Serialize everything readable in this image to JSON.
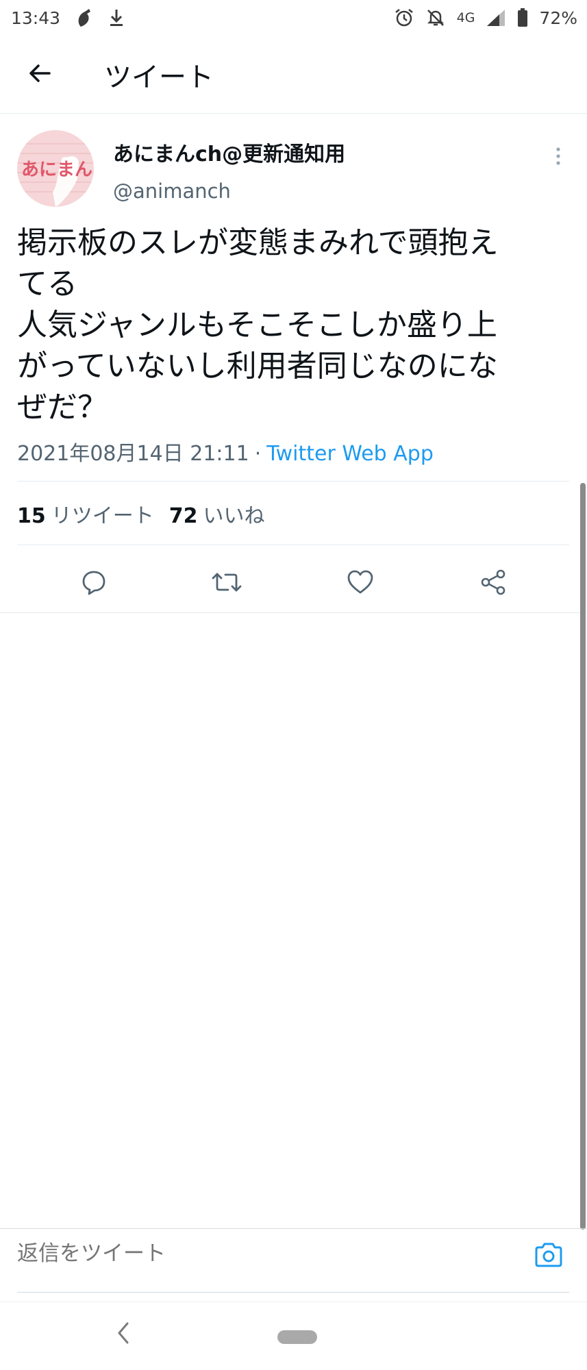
{
  "status_bar": {
    "time": "13:43",
    "network": "4G",
    "battery": "72%",
    "icons": [
      "app-notification-icon",
      "download-icon",
      "alarm-icon",
      "mute-icon",
      "signal-icon",
      "battery-icon"
    ]
  },
  "header": {
    "title": "ツイート",
    "back_icon": "arrow-left-icon"
  },
  "tweet": {
    "author": {
      "display_name": "あにまんch@更新通知用",
      "handle": "@animanch",
      "avatar_text": "あにまん"
    },
    "text": "掲示板のスレが変態まみれで頭抱え\nてる\n人気ジャンルもそこそこしか盛り上\nがっていないし利用者同じなのにな\nぜだ？",
    "timestamp": "2021年08月14日 21:11",
    "separator": "·",
    "source": "Twitter Web App",
    "retweets": {
      "count": "15",
      "label": "リツイート"
    },
    "likes": {
      "count": "72",
      "label": "いいね"
    },
    "actions": [
      "reply-icon",
      "retweet-icon",
      "like-icon",
      "share-icon"
    ]
  },
  "reply": {
    "placeholder": "返信をツイート",
    "camera_icon": "camera-icon"
  },
  "colors": {
    "accent": "#1d9bf0",
    "text_primary": "#0f1419",
    "text_secondary": "#536471",
    "divider": "#e6ecf0"
  }
}
